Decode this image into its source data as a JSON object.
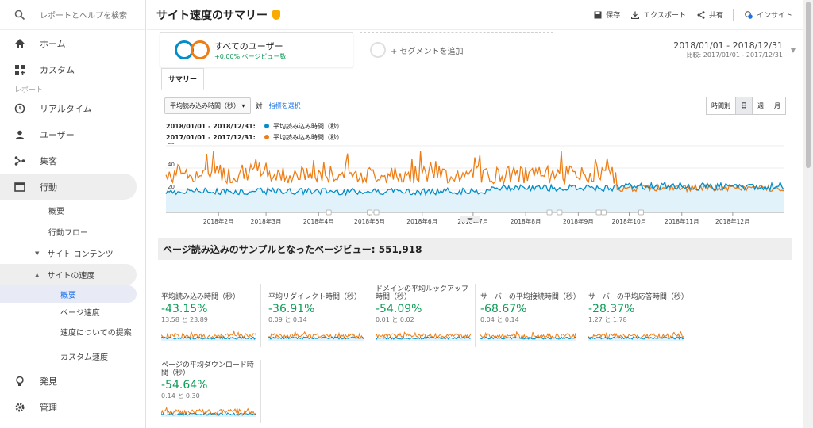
{
  "sidebar": {
    "search_placeholder": "レポートとヘルプを検索",
    "home": "ホーム",
    "custom": "カスタム",
    "section_reports": "レポート",
    "realtime": "リアルタイム",
    "users": "ユーザー",
    "acquisition": "集客",
    "behavior": "行動",
    "overview": "概要",
    "behavior_flow": "行動フロー",
    "site_content": "サイト コンテンツ",
    "site_speed": "サイトの速度",
    "speed_overview": "概要",
    "page_timings": "ページ速度",
    "speed_suggestions": "速度についての提案",
    "user_timings": "カスタム速度",
    "discover": "発見",
    "admin": "管理"
  },
  "header": {
    "title": "サイト速度のサマリー",
    "save": "保存",
    "export": "エクスポート",
    "share": "共有",
    "insights": "インサイト"
  },
  "segment": {
    "name": "すべてのユーザー",
    "sub": "+0.00% ページビュー数",
    "add": "+ セグメントを追加"
  },
  "date": {
    "range": "2018/01/01 - 2018/12/31",
    "compare": "比較: 2017/01/01 - 2017/12/31"
  },
  "tabs": {
    "summary": "サマリー"
  },
  "controls": {
    "metric": "平均読み込み時間（秒）",
    "vs": "対",
    "select_metric": "指標を選択",
    "hourly": "時間別",
    "day": "日",
    "week": "週",
    "month": "月"
  },
  "legend": [
    {
      "range": "2018/01/01 - 2018/12/31:",
      "name": "平均読み込み時間（秒）",
      "color": "#058dc7"
    },
    {
      "range": "2017/01/01 - 2017/12/31:",
      "name": "平均読み込み時間（秒）",
      "color": "#ed7e17"
    }
  ],
  "chart_data": {
    "type": "line",
    "title": "",
    "ylabel": "",
    "xlabel": "",
    "ylim": [
      0,
      60
    ],
    "yticks": [
      20,
      40,
      60
    ],
    "xticks": [
      "2018年2月",
      "2018年3月",
      "2018年4月",
      "2018年5月",
      "2018年6月",
      "2018年7月",
      "2018年8月",
      "2018年9月",
      "2018年10月",
      "2018年11月",
      "2018年12月"
    ],
    "series": [
      {
        "name": "2018/01/01 - 2018/12/31",
        "color": "#058dc7",
        "approx_min": 14,
        "approx_max": 26
      },
      {
        "name": "2017/01/01 - 2017/12/31",
        "color": "#ed7e17",
        "approx_min": 15,
        "approx_max": 58
      }
    ]
  },
  "sample": {
    "text": "ページ読み込みのサンプルとなったページビュー: 551,918"
  },
  "metrics": [
    {
      "label": "平均読み込み時間（秒）",
      "value": "-43.15%",
      "range": "13.58 と 23.89"
    },
    {
      "label": "平均リダイレクト時間（秒）",
      "value": "-36.91%",
      "range": "0.09 と 0.14"
    },
    {
      "label": "ドメインの平均ルックアップ時間（秒）",
      "value": "-54.09%",
      "range": "0.01 と 0.02"
    },
    {
      "label": "サーバーの平均接続時間（秒）",
      "value": "-68.67%",
      "range": "0.04 と 0.14"
    },
    {
      "label": "サーバーの平均応答時間（秒）",
      "value": "-28.37%",
      "range": "1.27 と 1.78"
    },
    {
      "label": "ページの平均ダウンロード時間（秒）",
      "value": "-54.64%",
      "range": "0.14 と 0.30"
    }
  ]
}
